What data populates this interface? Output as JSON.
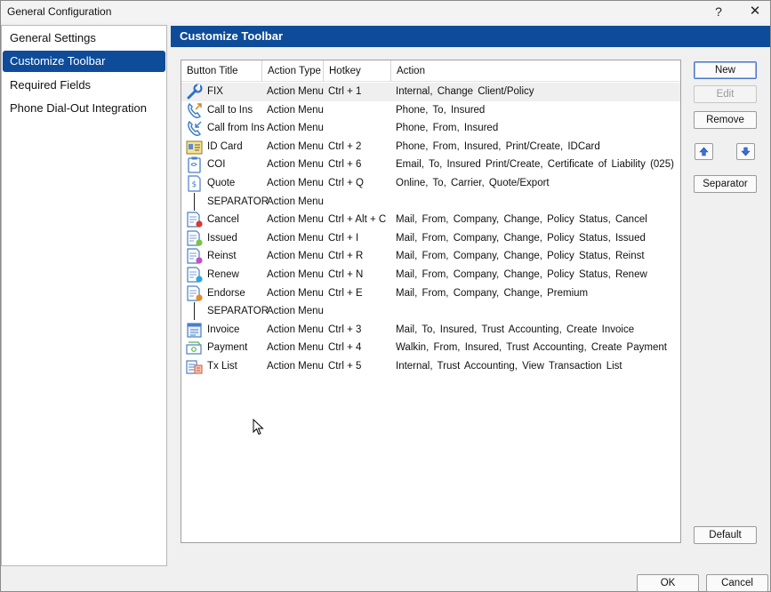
{
  "window": {
    "title": "General Configuration",
    "help_label": "?",
    "close_label": "✕"
  },
  "sidebar": {
    "items": [
      {
        "label": "General Settings",
        "active": false
      },
      {
        "label": "Customize Toolbar",
        "active": true
      },
      {
        "label": "Required Fields",
        "active": false
      },
      {
        "label": "Phone Dial-Out Integration",
        "active": false
      }
    ]
  },
  "main": {
    "header": "Customize Toolbar",
    "columns": [
      "Button Title",
      "Action Type",
      "Hotkey",
      "Action"
    ],
    "rows": [
      {
        "icon": "wrench-icon",
        "title": "FIX",
        "type": "Action Menu",
        "hotkey": "Ctrl + 1",
        "action": "Internal, Change Client/Policy"
      },
      {
        "icon": "phone-outgoing-icon",
        "title": "Call to Ins",
        "type": "Action Menu",
        "hotkey": "",
        "action": "Phone, To, Insured"
      },
      {
        "icon": "phone-incoming-icon",
        "title": "Call from Ins",
        "type": "Action Menu",
        "hotkey": "",
        "action": "Phone, From, Insured"
      },
      {
        "icon": "id-card-icon",
        "title": "ID Card",
        "type": "Action Menu",
        "hotkey": "Ctrl + 2",
        "action": "Phone, From, Insured, Print/Create, IDCard"
      },
      {
        "icon": "clipboard-icon",
        "title": "COI",
        "type": "Action Menu",
        "hotkey": "Ctrl + 6",
        "action": "Email, To, Insured Print/Create, Certificate of Liability (025)"
      },
      {
        "icon": "quote-document-icon",
        "title": "Quote",
        "type": "Action Menu",
        "hotkey": "Ctrl + Q",
        "action": "Online, To, Carrier, Quote/Export"
      },
      {
        "icon": "separator-icon",
        "title": "SEPARATOR",
        "type": "Action Menu",
        "hotkey": "",
        "action": ""
      },
      {
        "icon": "cancel-document-icon",
        "title": "Cancel",
        "type": "Action Menu",
        "hotkey": "Ctrl + Alt + C",
        "action": "Mail, From, Company, Change, Policy Status, Cancel"
      },
      {
        "icon": "issued-document-icon",
        "title": "Issued",
        "type": "Action Menu",
        "hotkey": "Ctrl + I",
        "action": "Mail, From, Company, Change, Policy Status, Issued"
      },
      {
        "icon": "reinstate-document-icon",
        "title": "Reinst",
        "type": "Action Menu",
        "hotkey": "Ctrl + R",
        "action": "Mail, From, Company, Change, Policy Status, Reinst"
      },
      {
        "icon": "renew-document-icon",
        "title": "Renew",
        "type": "Action Menu",
        "hotkey": "Ctrl + N",
        "action": "Mail, From, Company, Change, Policy Status, Renew"
      },
      {
        "icon": "endorse-document-icon",
        "title": "Endorse",
        "type": "Action Menu",
        "hotkey": "Ctrl + E",
        "action": "Mail, From, Company, Change, Premium"
      },
      {
        "icon": "separator-icon",
        "title": "SEPARATOR",
        "type": "Action Menu",
        "hotkey": "",
        "action": ""
      },
      {
        "icon": "invoice-icon",
        "title": "Invoice",
        "type": "Action Menu",
        "hotkey": "Ctrl + 3",
        "action": "Mail, To, Insured, Trust Accounting, Create Invoice"
      },
      {
        "icon": "payment-icon",
        "title": "Payment",
        "type": "Action Menu",
        "hotkey": "Ctrl + 4",
        "action": "Walkin, From, Insured, Trust Accounting, Create Payment"
      },
      {
        "icon": "transaction-list-icon",
        "title": "Tx List",
        "type": "Action Menu",
        "hotkey": "Ctrl + 5",
        "action": "Internal, Trust Accounting, View Transaction List"
      }
    ]
  },
  "buttons": {
    "new": "New",
    "edit": "Edit",
    "remove": "Remove",
    "separator": "Separator",
    "default": "Default",
    "ok": "OK",
    "cancel": "Cancel"
  },
  "colors": {
    "accent": "#0e4c9a"
  }
}
